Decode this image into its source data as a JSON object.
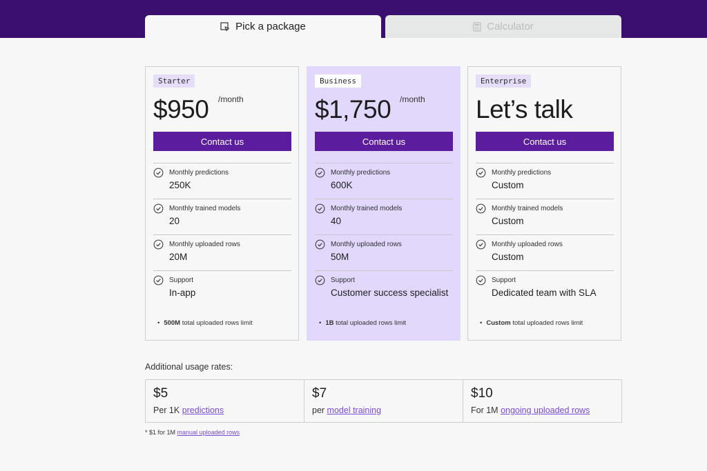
{
  "tabs": [
    {
      "label": "Pick a package",
      "icon": "cursor-select-icon",
      "active": true
    },
    {
      "label": "Calculator",
      "icon": "calculator-icon",
      "active": false
    }
  ],
  "plans": [
    {
      "badge": "Starter",
      "price": "$950",
      "per": "/month",
      "cta": "Contact us",
      "features": [
        {
          "label": "Monthly predictions",
          "value": "250K"
        },
        {
          "label": "Monthly trained models",
          "value": "20"
        },
        {
          "label": "Monthly uploaded rows",
          "value": "20M"
        },
        {
          "label": "Support",
          "value": "In-app"
        }
      ],
      "note_bold": "500M",
      "note_text": " total uploaded rows limit"
    },
    {
      "badge": "Business",
      "price": "$1,750",
      "per": "/month",
      "cta": "Contact us",
      "features": [
        {
          "label": "Monthly predictions",
          "value": "600K"
        },
        {
          "label": "Monthly trained models",
          "value": "40"
        },
        {
          "label": "Monthly uploaded rows",
          "value": "50M"
        },
        {
          "label": "Support",
          "value": "Customer success specialist"
        }
      ],
      "note_bold": "1B",
      "note_text": " total uploaded rows limit"
    },
    {
      "badge": "Enterprise",
      "price": "Let’s talk",
      "per": "",
      "cta": "Contact us",
      "features": [
        {
          "label": "Monthly predictions",
          "value": "Custom"
        },
        {
          "label": "Monthly trained models",
          "value": "Custom"
        },
        {
          "label": "Monthly uploaded rows",
          "value": "Custom"
        },
        {
          "label": "Support",
          "value": "Dedicated team with SLA"
        }
      ],
      "note_bold": "Custom",
      "note_text": " total uploaded rows limit"
    }
  ],
  "additional": {
    "title": "Additional usage rates:",
    "rates": [
      {
        "amount": "$5",
        "prefix": "Per 1K ",
        "link": "predictions"
      },
      {
        "amount": "$7",
        "prefix": "per ",
        "link": "model training"
      },
      {
        "amount": "$10",
        "prefix": "For 1M ",
        "link": "ongoing uploaded rows"
      }
    ],
    "footnote_prefix": "* $1 for 1M ",
    "footnote_link": "manual uploaded rows"
  },
  "colors": {
    "header": "#3b0f6e",
    "button": "#5b1d9e",
    "highlight": "#e2d8fb",
    "link": "#7a4bd6"
  }
}
